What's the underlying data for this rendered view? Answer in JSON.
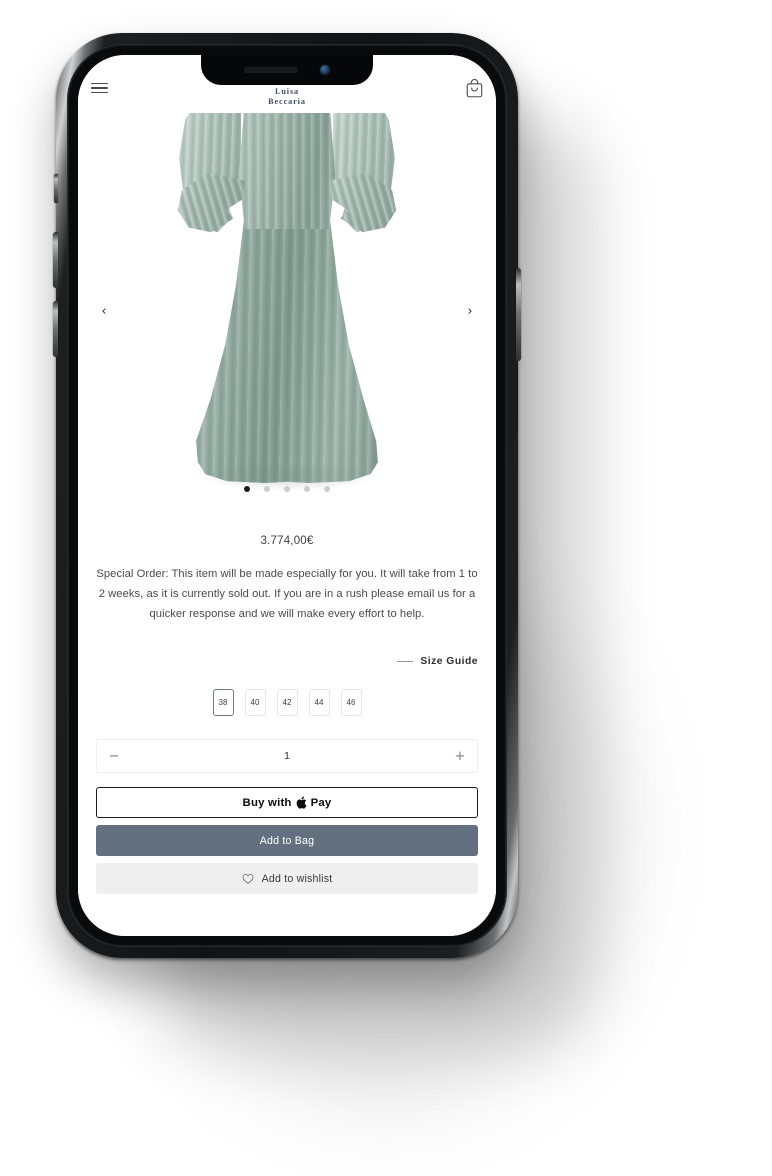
{
  "device": {
    "name": "iphone-x-mockup",
    "notch": {
      "speaker": "earpiece-speaker",
      "camera": "front-camera"
    },
    "buttons": [
      "silent-switch",
      "volume-up",
      "volume-down",
      "power"
    ]
  },
  "header": {
    "menu_icon": "hamburger-menu-icon",
    "brand_mark": "luisa-beccaria-petal-logo",
    "brand_line1": "Luisa",
    "brand_line2": "Beccaria",
    "bag_icon": "shopping-bag-icon"
  },
  "gallery": {
    "prev_label": "‹",
    "next_label": "›",
    "alt": "sage green pleated gown with ruffled off-shoulder sleeves",
    "dots": 5,
    "active_dot": 0,
    "colors": {
      "fabric": "#8ea79c",
      "fabric_light": "#b9cbc3",
      "fabric_dark": "#7f9a8e"
    }
  },
  "product": {
    "price": "3.774,00€",
    "description": "Special Order: This item will be made especially for you. It will take from 1 to 2 weeks, as it is currently sold out. If you are in a rush please email us for a quicker response and we will make every effort to help.",
    "size_guide_label": "Size Guide",
    "sizes": [
      "38",
      "40",
      "42",
      "44",
      "46"
    ],
    "selected_size": "38",
    "quantity": {
      "decrement_label": "−",
      "value": "1",
      "increment_label": "+"
    }
  },
  "actions": {
    "apple_pay_prefix": "Buy with",
    "apple_pay_glyph": "",
    "apple_pay_suffix": "Pay",
    "add_to_bag_label": "Add to Bag",
    "wishlist_icon": "heart-icon",
    "wishlist_label": "Add to wishlist"
  },
  "colors": {
    "accent_bag": "#62707f",
    "wishlist_bg": "#efefef",
    "brand_navy": "#404c5c",
    "selected_size_border": "#6c7b8c"
  }
}
